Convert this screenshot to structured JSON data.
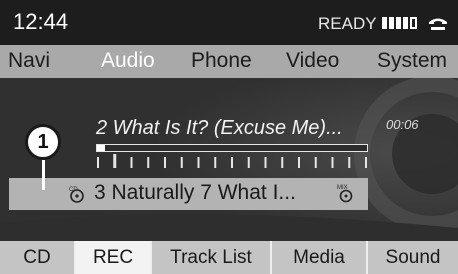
{
  "status": {
    "time": "12:44",
    "ready": "READY",
    "signal_bars_filled": 4,
    "signal_bars_total": 5,
    "phone_icon": "phone-handset-icon"
  },
  "top_menu": {
    "items": [
      {
        "label": "Navi"
      },
      {
        "label": "Audio",
        "active": true
      },
      {
        "label": "Phone"
      },
      {
        "label": "Video"
      },
      {
        "label": "System"
      }
    ]
  },
  "track": {
    "title": "2 What Is It? (Excuse Me)...",
    "elapsed": "00:06",
    "progress_fraction": 0.03,
    "next_track": "3 Naturally 7   What I...",
    "cd_icon": "cd-icon",
    "mix_icon": "mix-icon"
  },
  "callout": {
    "label": "1"
  },
  "bottom_menu": {
    "items": [
      {
        "label": "CD"
      },
      {
        "label": "REC",
        "active": true
      },
      {
        "label": "Track List"
      },
      {
        "label": "Media"
      },
      {
        "label": "Sound"
      }
    ]
  },
  "colors": {
    "status_bg": "#1d1d1d",
    "top_menu_bg": "#a9a9a9",
    "main_bg": "#3a3a3a",
    "bottom_menu_bg": "#c4c4c4",
    "active_tab_bg": "#f3f3f3"
  }
}
